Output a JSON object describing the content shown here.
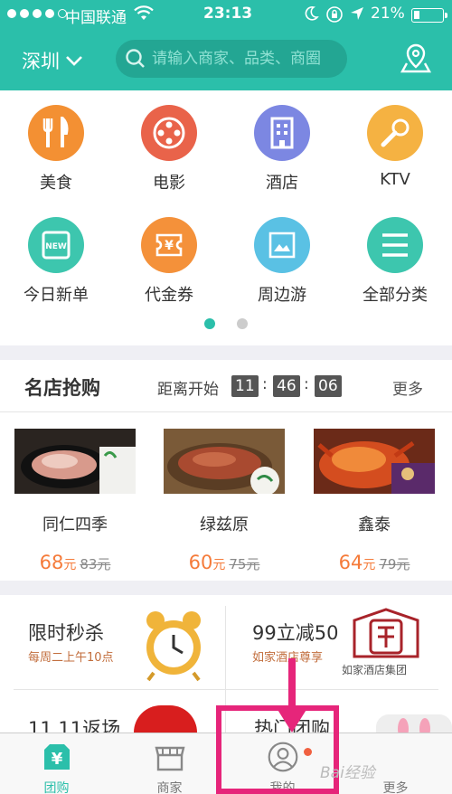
{
  "status_bar": {
    "carrier": "中国联通",
    "time": "23:13",
    "battery": "21%",
    "battery_level": 0.21
  },
  "header": {
    "city": "深圳",
    "search_placeholder": "请输入商家、品类、商圈"
  },
  "categories": [
    {
      "label": "美食",
      "color": "#f39033",
      "icon": "fork-knife-icon"
    },
    {
      "label": "电影",
      "color": "#e9634a",
      "icon": "film-reel-icon"
    },
    {
      "label": "酒店",
      "color": "#7c87e2",
      "icon": "building-icon"
    },
    {
      "label": "KTV",
      "color": "#f5b242",
      "icon": "microphone-icon"
    },
    {
      "label": "今日新单",
      "color": "#3dc6ae",
      "icon": "new-badge-icon"
    },
    {
      "label": "代金券",
      "color": "#f4913a",
      "icon": "voucher-icon"
    },
    {
      "label": "周边游",
      "color": "#5ac1e4",
      "icon": "ticket-icon"
    },
    {
      "label": "全部分类",
      "color": "#3dc6ae",
      "icon": "menu-icon"
    }
  ],
  "flash_sale": {
    "title": "名店抢购",
    "countdown_label": "距离开始",
    "hours": "11",
    "minutes": "46",
    "seconds": "06",
    "more": "更多",
    "shops": [
      {
        "name": "同仁四季",
        "price": "68",
        "unit": "元",
        "old": "83元"
      },
      {
        "name": "绿兹原",
        "price": "60",
        "unit": "元",
        "old": "75元"
      },
      {
        "name": "鑫泰",
        "price": "64",
        "unit": "元",
        "old": "79元"
      }
    ]
  },
  "promos": {
    "p1_title": "限时秒杀",
    "p1_sub": "每周二上午10点",
    "p2_title": "99立减50",
    "p2_sub": "如家酒店尊享",
    "p2_brand": "如家酒店集团",
    "p3_title": "11.11返场",
    "p4_title": "热门团购"
  },
  "tabbar": {
    "tab1": "团购",
    "tab2": "商家",
    "tab3": "我的",
    "tab4": "更多"
  },
  "watermark": "Bai经验",
  "colors": {
    "accent": "#2bbfaa",
    "price": "#f57b3a",
    "highlight": "#e6257a"
  }
}
